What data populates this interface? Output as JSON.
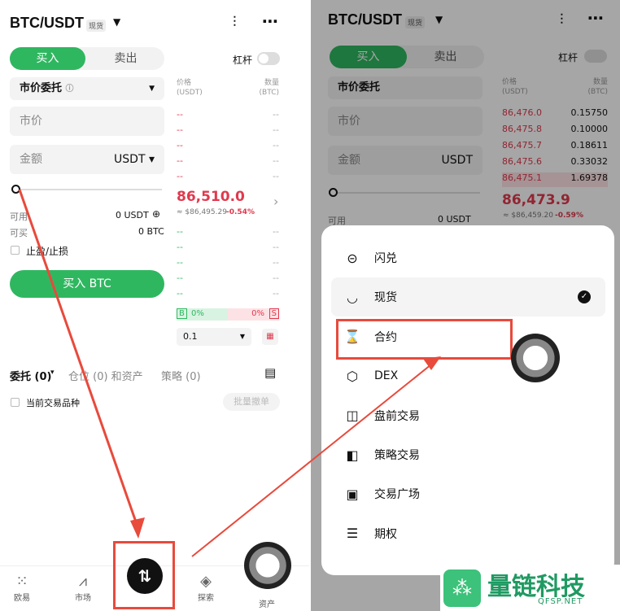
{
  "pair": "BTC/USDT",
  "pair_tag": "现货",
  "buy_tab": "买入",
  "sell_tab": "卖出",
  "leverage_label": "杠杆",
  "order_type": "市价委托",
  "price_placeholder": "市价",
  "amount_placeholder": "金额",
  "amount_unit": "USDT",
  "available_label": "可用",
  "available_value": "0 USDT",
  "can_buy_label": "可买",
  "can_buy_value": "0 BTC",
  "tpsl_label": "止盈/止损",
  "buy_button": "买入 BTC",
  "ob_price_header": "价格\n(USDT)",
  "ob_qty_header": "数量\n(BTC)",
  "ob_price_header_1": "价格",
  "ob_price_header_2": "(USDT)",
  "ob_qty_header_1": "数量",
  "ob_qty_header_2": "(BTC)",
  "left_last_price": "86,510.0",
  "left_index": "≈ $86,495.29",
  "left_change": "-0.54%",
  "right_last_price": "86,473.9",
  "right_index": "≈ $86,459.20",
  "right_change": "-0.59%",
  "dash": "--",
  "buy_pct": "0%",
  "sell_pct": "0%",
  "b_label": "B",
  "s_label": "S",
  "depth_step": "0.1",
  "orders_tab": "委托 (0)",
  "positions_tab": "仓位 (0) 和资产",
  "strategy_tab": "策略 (0)",
  "current_pair_label": "当前交易品种",
  "batch_cancel": "批量撤单",
  "nav": [
    "欧易",
    "市场",
    "交易",
    "探索",
    "资产"
  ],
  "right_asks": [
    {
      "p": "86,476.0",
      "q": "0.15750"
    },
    {
      "p": "86,475.8",
      "q": "0.10000"
    },
    {
      "p": "86,475.7",
      "q": "0.18611"
    },
    {
      "p": "86,475.6",
      "q": "0.33032"
    },
    {
      "p": "86,475.1",
      "q": "1.69378"
    }
  ],
  "menu": [
    "闪兑",
    "现货",
    "合约",
    "DEX",
    "盘前交易",
    "策略交易",
    "交易广场",
    "期权"
  ],
  "watermark_text": "量链科技",
  "watermark_url": "QFSP.NET"
}
